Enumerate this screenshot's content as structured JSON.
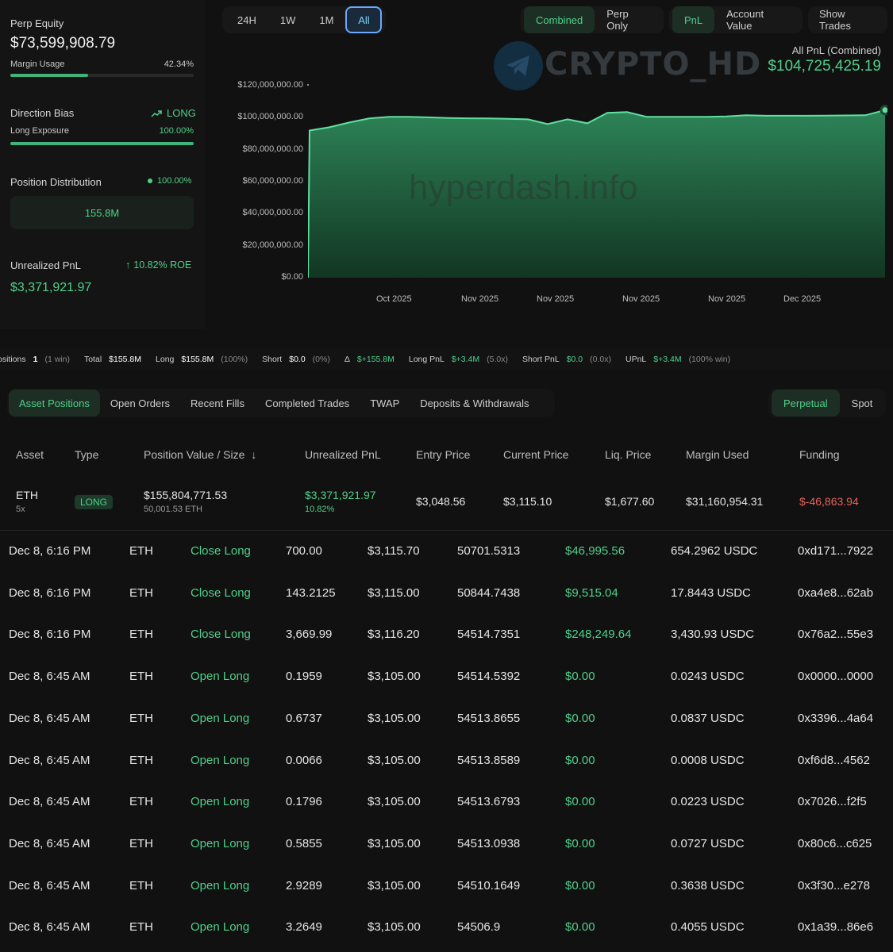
{
  "left": {
    "perp_equity_label": "Perp Equity",
    "perp_equity_value": "$73,599,908.79",
    "margin_usage_label": "Margin Usage",
    "margin_usage_value": "42.34%",
    "margin_usage_fraction": 0.4234,
    "direction_bias_label": "Direction Bias",
    "direction_bias_value": "LONG",
    "long_exposure_label": "Long Exposure",
    "long_exposure_value": "100.00%",
    "long_exposure_fraction": 1.0,
    "position_distribution_label": "Position Distribution",
    "position_distribution_value": "100.00%",
    "position_distribution_amount": "155.8M",
    "unrealized_pnl_label": "Unrealized PnL",
    "roe_value": "10.82% ROE",
    "unrealized_pnl_value": "$3,371,921.97"
  },
  "chart_controls": {
    "ranges": [
      "24H",
      "1W",
      "1M",
      "All"
    ],
    "active_range": "All",
    "modes": [
      "Combined",
      "Perp Only"
    ],
    "active_mode": "Combined",
    "metrics": [
      "PnL",
      "Account Value"
    ],
    "active_metric": "PnL",
    "show_trades": "Show Trades"
  },
  "watermarks": {
    "logo_text": "CRYPTO_HD",
    "site_text": "hyperdash.info"
  },
  "chart_header": {
    "title": "All PnL (Combined)",
    "value": "$104,725,425.19"
  },
  "chart_data": {
    "type": "area",
    "y_ticks": [
      "$120,000,000.00",
      "$100,000,000.00",
      "$80,000,000.00",
      "$60,000,000.00",
      "$40,000,000.00",
      "$20,000,000.00",
      "$0.00"
    ],
    "ylim": [
      0,
      120000000
    ],
    "x_ticks": [
      "Oct 2025",
      "Nov 2025",
      "Nov 2025",
      "Nov 2025",
      "Nov 2025",
      "Dec 2025"
    ],
    "values": [
      0,
      92000000,
      94000000,
      97000000,
      99500000,
      100500000,
      100500000,
      100200000,
      99800000,
      99600000,
      99500000,
      99300000,
      99000000,
      96000000,
      99000000,
      96500000,
      103000000,
      103500000,
      100500000,
      100500000,
      100500000,
      100500000,
      100800000,
      101500000,
      101200000,
      101200000,
      101200000,
      101300000,
      101400000,
      101500000,
      104725425
    ],
    "color": "#3fb37a"
  },
  "summary": {
    "positions_label": "Positions",
    "positions_value": "1",
    "positions_win": "(1 win)",
    "total_label": "Total",
    "total_value": "$155.8M",
    "long_label": "Long",
    "long_value": "$155.8M",
    "long_pct": "(100%)",
    "short_label": "Short",
    "short_value": "$0.0",
    "short_pct": "(0%)",
    "delta_label": "Δ",
    "delta_value": "$+155.8M",
    "long_pnl_label": "Long PnL",
    "long_pnl_value": "$+3.4M",
    "long_pnl_x": "(5.0x)",
    "short_pnl_label": "Short PnL",
    "short_pnl_value": "$0.0",
    "short_pnl_x": "(0.0x)",
    "upnl_label": "UPnL",
    "upnl_value": "$+3.4M",
    "upnl_win": "(100% win)"
  },
  "tabs": [
    "Asset Positions",
    "Open Orders",
    "Recent Fills",
    "Completed Trades",
    "TWAP",
    "Deposits & Withdrawals"
  ],
  "active_tab": "Asset Positions",
  "market_tabs": [
    "Perpetual",
    "Spot"
  ],
  "active_market": "Perpetual",
  "position_table": {
    "headers": [
      "Asset",
      "Type",
      "Position Value / Size",
      "Unrealized PnL",
      "Entry Price",
      "Current Price",
      "Liq. Price",
      "Margin Used",
      "Funding"
    ],
    "row": {
      "asset": "ETH",
      "leverage": "5x",
      "type": "LONG",
      "position_value": "$155,804,771.53",
      "position_size": "50,001.53 ETH",
      "unrealized_pnl": "$3,371,921.97",
      "unrealized_pct": "10.82%",
      "entry_price": "$3,048.56",
      "current_price": "$3,115.10",
      "liq_price": "$1,677.60",
      "margin_used": "$31,160,954.31",
      "funding": "$-46,863.94"
    }
  },
  "trades": [
    {
      "time": "Dec 8, 6:16 PM",
      "coin": "ETH",
      "dir": "Close Long",
      "size": "700.00",
      "price": "$3,115.70",
      "value": "50701.5313",
      "pnl": "$46,995.56",
      "fee": "654.2962 USDC",
      "hash": "0xd171...7922"
    },
    {
      "time": "Dec 8, 6:16 PM",
      "coin": "ETH",
      "dir": "Close Long",
      "size": "143.2125",
      "price": "$3,115.00",
      "value": "50844.7438",
      "pnl": "$9,515.04",
      "fee": "17.8443 USDC",
      "hash": "0xa4e8...62ab"
    },
    {
      "time": "Dec 8, 6:16 PM",
      "coin": "ETH",
      "dir": "Close Long",
      "size": "3,669.99",
      "price": "$3,116.20",
      "value": "54514.7351",
      "pnl": "$248,249.64",
      "fee": "3,430.93 USDC",
      "hash": "0x76a2...55e3"
    },
    {
      "time": "Dec 8, 6:45 AM",
      "coin": "ETH",
      "dir": "Open Long",
      "size": "0.1959",
      "price": "$3,105.00",
      "value": "54514.5392",
      "pnl": "$0.00",
      "fee": "0.0243 USDC",
      "hash": "0x0000...0000"
    },
    {
      "time": "Dec 8, 6:45 AM",
      "coin": "ETH",
      "dir": "Open Long",
      "size": "0.6737",
      "price": "$3,105.00",
      "value": "54513.8655",
      "pnl": "$0.00",
      "fee": "0.0837 USDC",
      "hash": "0x3396...4a64"
    },
    {
      "time": "Dec 8, 6:45 AM",
      "coin": "ETH",
      "dir": "Open Long",
      "size": "0.0066",
      "price": "$3,105.00",
      "value": "54513.8589",
      "pnl": "$0.00",
      "fee": "0.0008 USDC",
      "hash": "0xf6d8...4562"
    },
    {
      "time": "Dec 8, 6:45 AM",
      "coin": "ETH",
      "dir": "Open Long",
      "size": "0.1796",
      "price": "$3,105.00",
      "value": "54513.6793",
      "pnl": "$0.00",
      "fee": "0.0223 USDC",
      "hash": "0x7026...f2f5"
    },
    {
      "time": "Dec 8, 6:45 AM",
      "coin": "ETH",
      "dir": "Open Long",
      "size": "0.5855",
      "price": "$3,105.00",
      "value": "54513.0938",
      "pnl": "$0.00",
      "fee": "0.0727 USDC",
      "hash": "0x80c6...c625"
    },
    {
      "time": "Dec 8, 6:45 AM",
      "coin": "ETH",
      "dir": "Open Long",
      "size": "2.9289",
      "price": "$3,105.00",
      "value": "54510.1649",
      "pnl": "$0.00",
      "fee": "0.3638 USDC",
      "hash": "0x3f30...e278"
    },
    {
      "time": "Dec 8, 6:45 AM",
      "coin": "ETH",
      "dir": "Open Long",
      "size": "3.2649",
      "price": "$3,105.00",
      "value": "54506.9",
      "pnl": "$0.00",
      "fee": "0.4055 USDC",
      "hash": "0x1a39...86e6"
    }
  ]
}
